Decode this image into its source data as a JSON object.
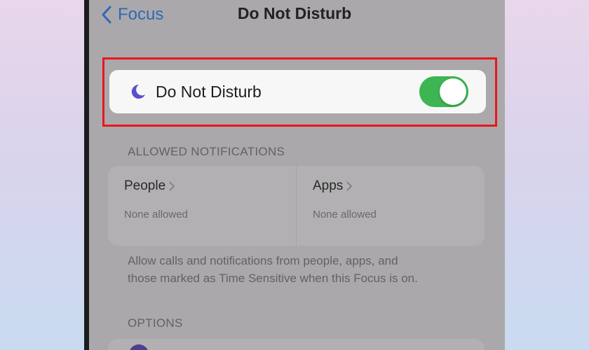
{
  "nav": {
    "back_label": "Focus",
    "title": "Do Not Disturb"
  },
  "dnd": {
    "label": "Do Not Disturb",
    "toggle_on": true
  },
  "allowed": {
    "header": "ALLOWED NOTIFICATIONS",
    "people": {
      "title": "People",
      "subtitle": "None allowed"
    },
    "apps": {
      "title": "Apps",
      "subtitle": "None allowed"
    },
    "footer_line1": "Allow calls and notifications from people, apps, and",
    "footer_line2": "those marked as Time Sensitive when this Focus is on."
  },
  "options": {
    "header": "OPTIONS"
  },
  "colors": {
    "accent_blue": "#2f68b8",
    "toggle_green": "#3db552",
    "moon_purple": "#5b4fd0",
    "highlight_red": "#e8171f"
  },
  "icons": {
    "back": "chevron-left-icon",
    "moon": "moon-icon",
    "chevron": "chevron-right-icon"
  }
}
